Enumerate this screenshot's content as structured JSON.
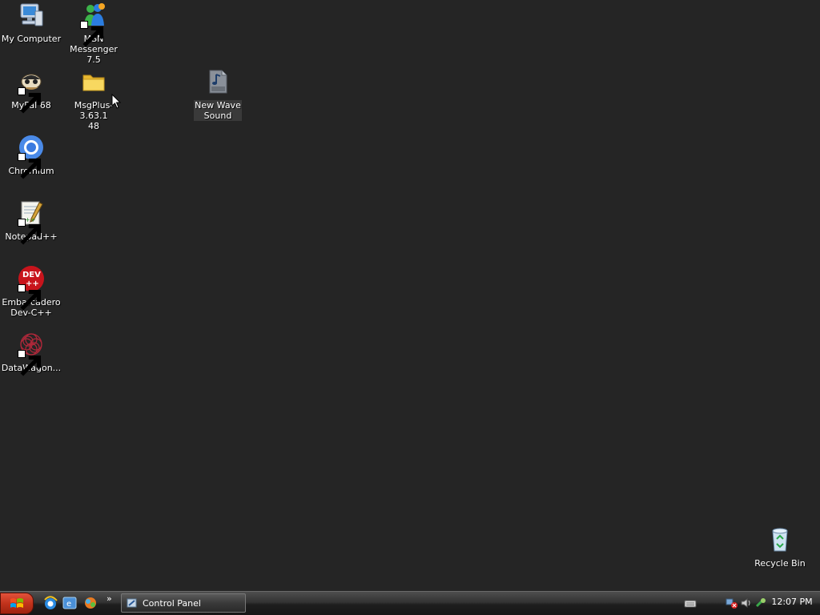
{
  "desktop": {
    "icons": [
      {
        "label": "My Computer"
      },
      {
        "label": "MSN\nMessenger 7.5"
      },
      {
        "label": "MyPal 68"
      },
      {
        "label": "MsgPlus-3.63.1\n48"
      },
      {
        "label": "New Wave\nSound"
      },
      {
        "label": "Chromium"
      },
      {
        "label": "Notepad++"
      },
      {
        "label": "Embarcadero\nDev-C++"
      },
      {
        "label": "DataWagon..."
      },
      {
        "label": "Recycle Bin"
      }
    ]
  },
  "taskbar": {
    "task_button_label": "Control Panel",
    "clock": "12:07 PM"
  },
  "colors": {
    "desktop_background": "#252525",
    "start_button": "#c1331c"
  }
}
